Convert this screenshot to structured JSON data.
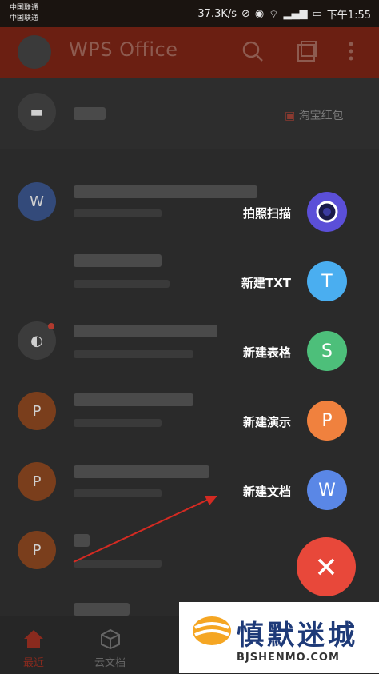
{
  "status_bar": {
    "carrier1": "中国联通",
    "carrier2": "中国联通",
    "speed": "37.3K/s",
    "time": "下午1:55"
  },
  "app_bar": {
    "title": "WPS Office"
  },
  "list": {
    "promo_label": "淘宝红包"
  },
  "fab_menu": {
    "items": [
      {
        "label": "拍照扫描",
        "icon": "camera-lens-icon",
        "color": "#5b4fd8"
      },
      {
        "label": "新建TXT",
        "icon": "T",
        "color": "#4aaef0"
      },
      {
        "label": "新建表格",
        "icon": "S",
        "color": "#4dbf7a"
      },
      {
        "label": "新建演示",
        "icon": "P",
        "color": "#f0813e"
      },
      {
        "label": "新建文档",
        "icon": "W",
        "color": "#5a87e6"
      }
    ],
    "close_icon": "close-icon",
    "close_color": "#e8483a"
  },
  "bottom_nav": {
    "tabs": [
      {
        "label": "最近",
        "icon": "home-icon",
        "active_color": "#d6452f"
      },
      {
        "label": "云文档",
        "icon": "cube-icon"
      }
    ]
  },
  "watermark": {
    "text": "慎默迷城",
    "sub": "BJSHENMO.COM"
  }
}
